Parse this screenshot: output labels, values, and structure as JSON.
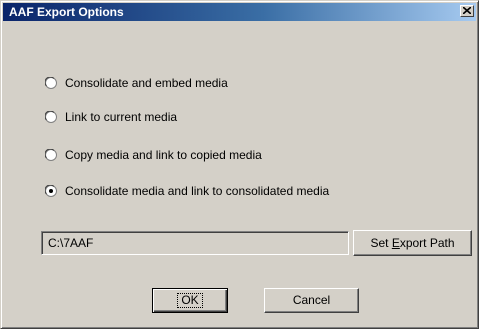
{
  "window": {
    "title": "AAF Export Options"
  },
  "options": [
    {
      "label": "Consolidate and embed media",
      "selected": false
    },
    {
      "label": "Link to current media",
      "selected": false
    },
    {
      "label": "Copy media and link to copied media",
      "selected": false
    },
    {
      "label": "Consolidate media and link to consolidated media",
      "selected": true
    }
  ],
  "export_path": {
    "value": "C:\\7AAF",
    "button_label_before": "Set ",
    "button_label_mnemonic": "E",
    "button_label_after": "xport Path"
  },
  "buttons": {
    "ok": "OK",
    "cancel": "Cancel"
  },
  "colors": {
    "dialog_bg": "#d4d0c8",
    "title_start": "#0a246a",
    "title_end": "#a6caf0"
  }
}
